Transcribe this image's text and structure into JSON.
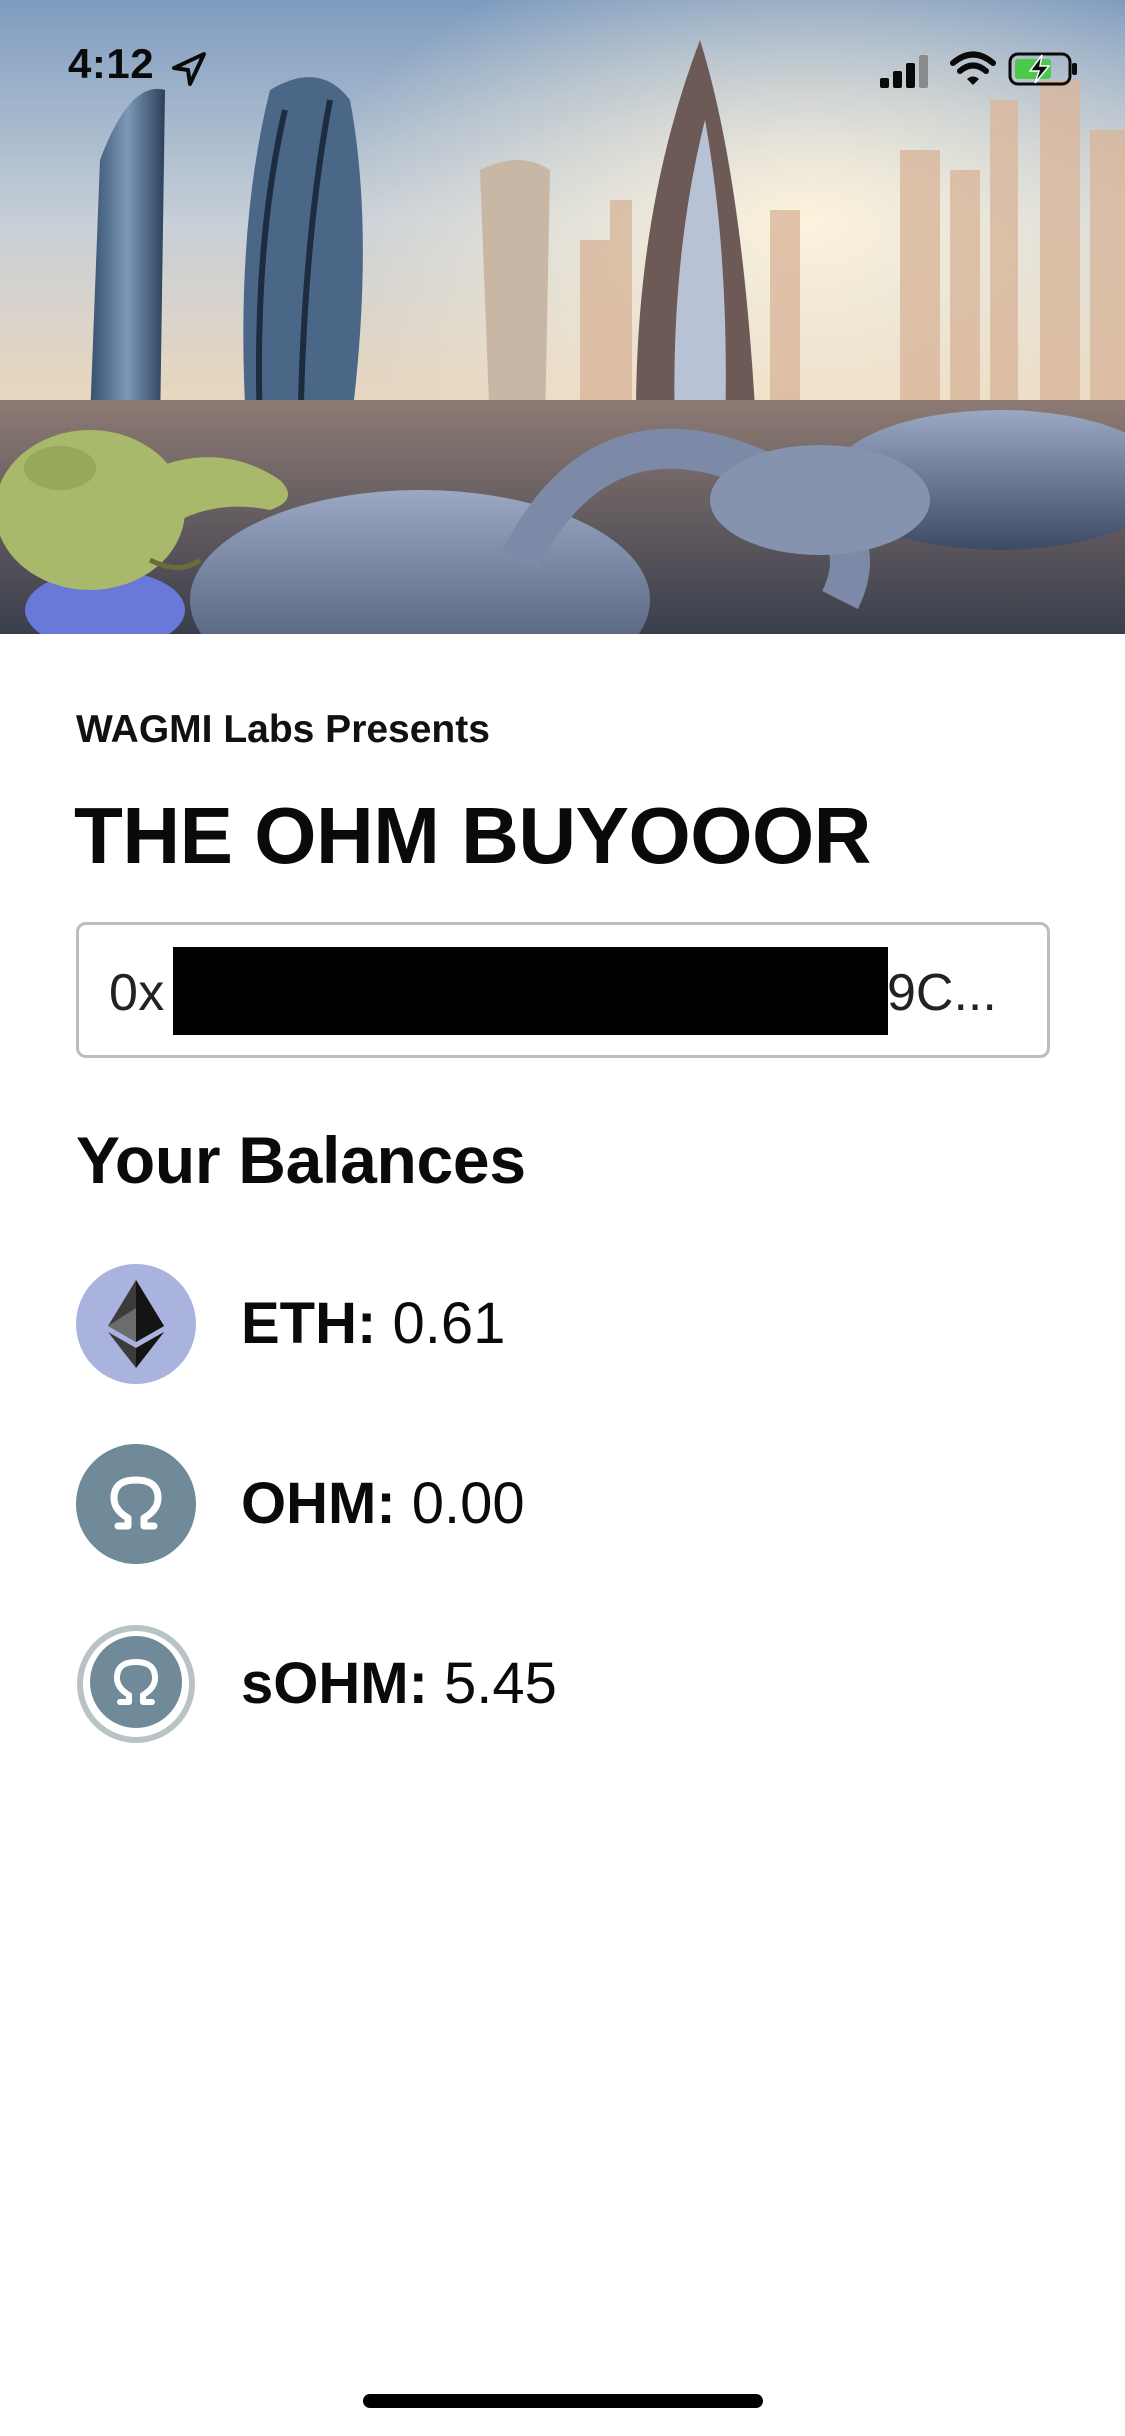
{
  "status_bar": {
    "time": "4:12",
    "icons": [
      "location-arrow-icon",
      "signal-icon",
      "wifi-icon",
      "battery-charging-icon"
    ]
  },
  "hero": {
    "description_icon": "futuristic-city-image",
    "colors": {
      "sky_top": "#6f8fb4",
      "sky_glow": "#f4d8b6",
      "frog": "#a8bb6a"
    }
  },
  "header": {
    "presents": "WAGMI Labs Presents",
    "title": "THE OHM BUYOOOR"
  },
  "address": {
    "prefix": "0x",
    "suffix": "9C..."
  },
  "balances": {
    "title": "Your Balances",
    "items": [
      {
        "icon": "eth-icon",
        "symbol": "ETH:",
        "value": "0.61",
        "color": "#a9b3de"
      },
      {
        "icon": "ohm-icon",
        "symbol": "OHM:",
        "value": "0.00",
        "color": "#708a99"
      },
      {
        "icon": "sohm-icon",
        "symbol": "sOHM:",
        "value": "5.45",
        "color": "#708a99"
      }
    ]
  }
}
